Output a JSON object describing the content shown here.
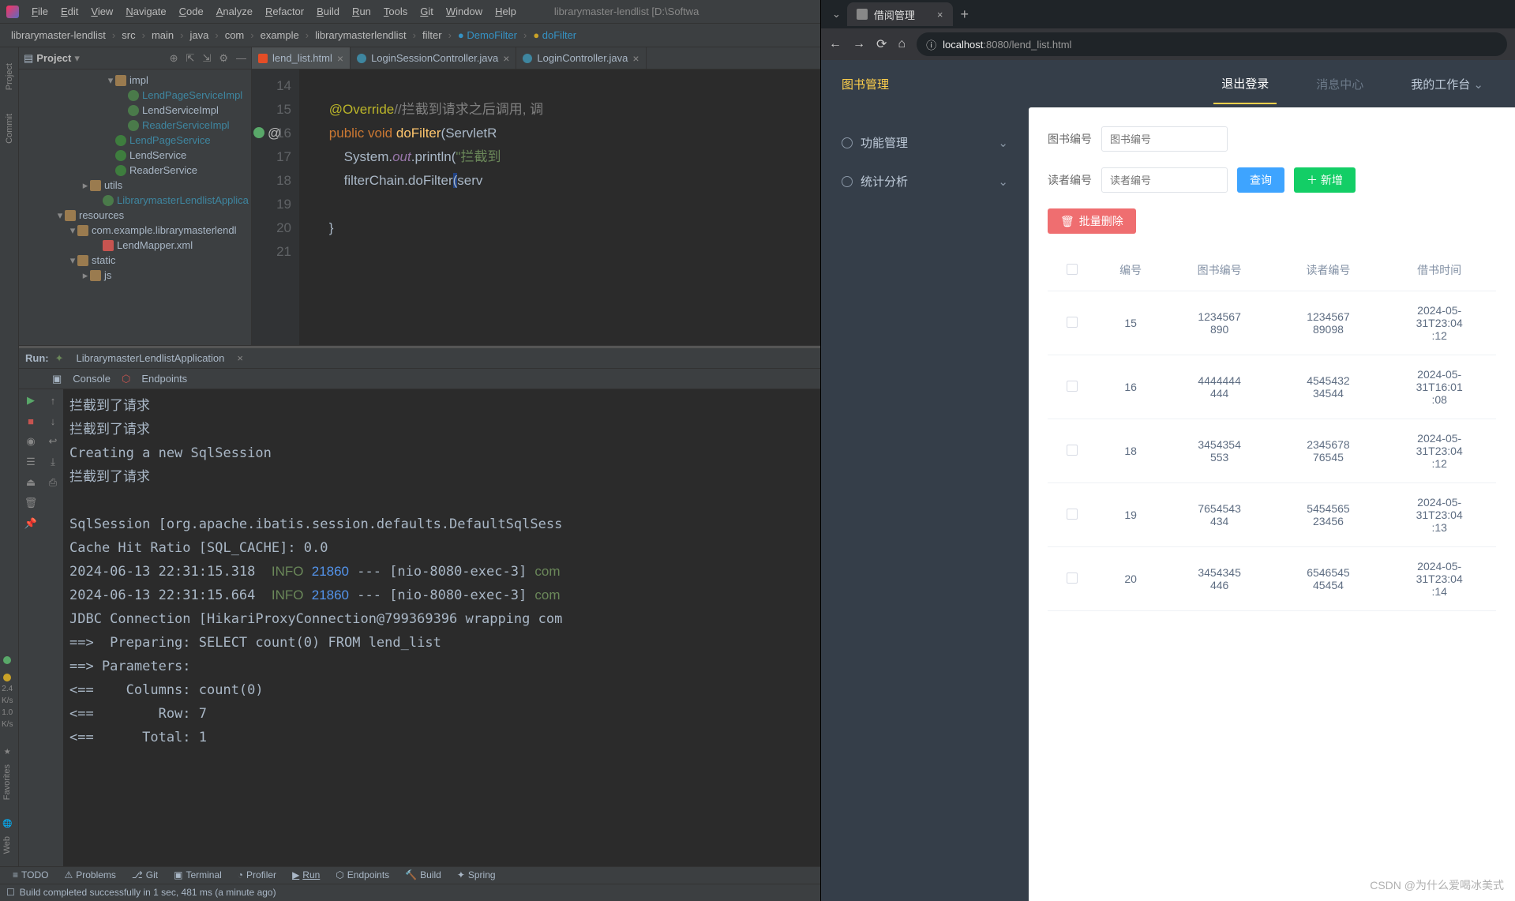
{
  "ide": {
    "title": "librarymaster-lendlist [D:\\Softwa",
    "menu": [
      "File",
      "Edit",
      "View",
      "Navigate",
      "Code",
      "Analyze",
      "Refactor",
      "Build",
      "Run",
      "Tools",
      "Git",
      "Window",
      "Help"
    ],
    "breadcrumb": [
      "librarymaster-lendlist",
      "src",
      "main",
      "java",
      "com",
      "example",
      "librarymasterlendlist",
      "filter",
      "DemoFilter",
      "doFilter"
    ],
    "project_label": "Project",
    "tree": [
      {
        "indent": 110,
        "arrow": "▾",
        "icon": "folder",
        "label": "impl"
      },
      {
        "indent": 126,
        "icon": "class",
        "label": "LendPageServiceImpl",
        "color": "#3e86a0"
      },
      {
        "indent": 126,
        "icon": "class",
        "label": "LendServiceImpl"
      },
      {
        "indent": 126,
        "icon": "class",
        "label": "ReaderServiceImpl",
        "color": "#3e86a0"
      },
      {
        "indent": 110,
        "icon": "iface",
        "label": "LendPageService",
        "color": "#3e86a0"
      },
      {
        "indent": 110,
        "icon": "iface",
        "label": "LendService"
      },
      {
        "indent": 110,
        "icon": "iface",
        "label": "ReaderService"
      },
      {
        "indent": 78,
        "arrow": "▸",
        "icon": "folder",
        "label": "utils"
      },
      {
        "indent": 94,
        "icon": "class",
        "label": "LibrarymasterLendlistApplica",
        "color": "#3e86a0"
      },
      {
        "indent": 46,
        "arrow": "▾",
        "icon": "folder",
        "label": "resources"
      },
      {
        "indent": 62,
        "arrow": "▾",
        "icon": "folder",
        "label": "com.example.librarymasterlendl"
      },
      {
        "indent": 94,
        "icon": "xml",
        "label": "LendMapper.xml"
      },
      {
        "indent": 62,
        "arrow": "▾",
        "icon": "folder",
        "label": "static"
      },
      {
        "indent": 78,
        "arrow": "▸",
        "icon": "folder",
        "label": "js"
      }
    ],
    "editor_tabs": [
      {
        "icon": "html",
        "label": "lend_list.html"
      },
      {
        "icon": "java",
        "label": "LoginSessionController.java"
      },
      {
        "icon": "java",
        "label": "LoginController.java"
      }
    ],
    "line_numbers": [
      "14",
      "15",
      "16",
      "17",
      "18",
      "19",
      "20",
      "21"
    ],
    "run_label": "Run:",
    "run_tab": "LibrarymasterLendlistApplication",
    "console_tab": "Console",
    "endpoints_tab": "Endpoints",
    "status_tabs": [
      "TODO",
      "Problems",
      "Git",
      "Terminal",
      "Profiler",
      "Run",
      "Endpoints",
      "Build",
      "Spring"
    ],
    "status_msg": "Build completed successfully in 1 sec, 481 ms (a minute ago)",
    "left_tabs": [
      "Project",
      "Commit"
    ],
    "left_bottom_tabs": [
      "Favorites",
      "Web"
    ],
    "indicator2": "2.4",
    "indicator3": "K/s",
    "indicator4": "1.0",
    "indicator5": "K/s"
  },
  "browser": {
    "tab_title": "借阅管理",
    "url_host": "localhost",
    "url_port": ":8080",
    "url_path": "/lend_list.html",
    "app": {
      "book_mgmt": "图书管理",
      "logout": "退出登录",
      "msg_center": "消息中心",
      "workspace": "我的工作台",
      "func_mgmt": "功能管理",
      "stats": "统计分析",
      "book_id_label": "图书编号",
      "book_id_ph": "图书编号",
      "reader_id_label": "读者编号",
      "reader_id_ph": "读者编号",
      "search_btn": "查询",
      "add_btn": "新增",
      "batch_del": "批量删除",
      "th": [
        "",
        "编号",
        "图书编号",
        "读者编号",
        "借书时间"
      ],
      "rows": [
        {
          "id": "15",
          "book": "1234567890",
          "reader": "123456789098",
          "time": "2024-05-31T23:04:12"
        },
        {
          "id": "16",
          "book": "4444444444",
          "reader": "454543234544",
          "time": "2024-05-31T16:01:08"
        },
        {
          "id": "18",
          "book": "3454354553",
          "reader": "234567876545",
          "time": "2024-05-31T23:04:12"
        },
        {
          "id": "19",
          "book": "7654543434",
          "reader": "545456523456",
          "time": "2024-05-31T23:04:13"
        },
        {
          "id": "20",
          "book": "3454345446",
          "reader": "654654545454",
          "time": "2024-05-31T23:04:14"
        }
      ]
    }
  },
  "watermark": "CSDN @为什么爱喝冰美式"
}
